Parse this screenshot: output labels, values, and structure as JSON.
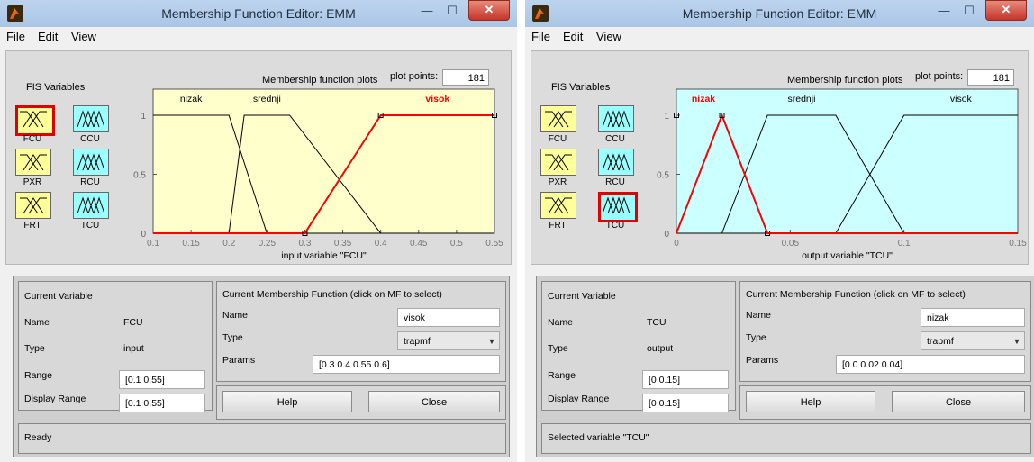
{
  "windows": [
    {
      "title": "Membership Function Editor: EMM",
      "menu": [
        "File",
        "Edit",
        "View"
      ],
      "fis_label": "FIS Variables",
      "variables": [
        {
          "name": "FCU",
          "kind": "input",
          "selected": true
        },
        {
          "name": "CCU",
          "kind": "output",
          "selected": false
        },
        {
          "name": "PXR",
          "kind": "input",
          "selected": false
        },
        {
          "name": "RCU",
          "kind": "output",
          "selected": false
        },
        {
          "name": "FRT",
          "kind": "input",
          "selected": false
        },
        {
          "name": "TCU",
          "kind": "output",
          "selected": false
        }
      ],
      "plot_header": "Membership function plots",
      "plot_points_label": "plot points:",
      "plot_points": "181",
      "chart_data": {
        "type": "line",
        "background": "#ffffcc",
        "xlabel": "input variable \"FCU\"",
        "xlim": [
          0.1,
          0.55
        ],
        "ylim": [
          0,
          1
        ],
        "xticks": [
          "0.1",
          "0.15",
          "0.2",
          "0.25",
          "0.3",
          "0.35",
          "0.4",
          "0.45",
          "0.5",
          "0.55"
        ],
        "yticks": [
          "0",
          "0.5",
          "1"
        ],
        "series": [
          {
            "name": "nizak",
            "params": [
              0.05,
              0.1,
              0.2,
              0.25
            ],
            "selected": false
          },
          {
            "name": "srednji",
            "params": [
              0.2,
              0.22,
              0.28,
              0.4
            ],
            "selected": false
          },
          {
            "name": "visok",
            "params": [
              0.3,
              0.4,
              0.55,
              0.6
            ],
            "selected": true
          }
        ]
      },
      "current_variable": {
        "header": "Current Variable",
        "name_label": "Name",
        "name": "FCU",
        "type_label": "Type",
        "type": "input",
        "range_label": "Range",
        "range": "[0.1 0.55]",
        "display_range_label": "Display Range",
        "display_range": "[0.1 0.55]"
      },
      "current_mf": {
        "header": "Current Membership Function (click on MF to select)",
        "name_label": "Name",
        "name": "visok",
        "type_label": "Type",
        "type": "trapmf",
        "params_label": "Params",
        "params": "[0.3 0.4 0.55 0.6]"
      },
      "help_label": "Help",
      "close_label": "Close",
      "status": "Ready"
    },
    {
      "title": "Membership Function Editor: EMM",
      "menu": [
        "File",
        "Edit",
        "View"
      ],
      "fis_label": "FIS Variables",
      "variables": [
        {
          "name": "FCU",
          "kind": "input",
          "selected": false
        },
        {
          "name": "CCU",
          "kind": "output",
          "selected": false
        },
        {
          "name": "PXR",
          "kind": "input",
          "selected": false
        },
        {
          "name": "RCU",
          "kind": "output",
          "selected": false
        },
        {
          "name": "FRT",
          "kind": "input",
          "selected": false
        },
        {
          "name": "TCU",
          "kind": "output",
          "selected": true
        }
      ],
      "plot_header": "Membership function plots",
      "plot_points_label": "plot points:",
      "plot_points": "181",
      "chart_data": {
        "type": "line",
        "background": "#ccffff",
        "xlabel": "output variable \"TCU\"",
        "xlim": [
          0,
          0.15
        ],
        "ylim": [
          0,
          1
        ],
        "xticks": [
          "0",
          "0.05",
          "0.1",
          "0.15"
        ],
        "yticks": [
          "0",
          "0.5",
          "1"
        ],
        "series": [
          {
            "name": "nizak",
            "params": [
              0,
              0,
              0.02,
              0.04
            ],
            "selected": true
          },
          {
            "name": "srednji",
            "params": [
              0.02,
              0.04,
              0.07,
              0.1
            ],
            "selected": false
          },
          {
            "name": "visok",
            "params": [
              0.07,
              0.1,
              0.15,
              0.16
            ],
            "selected": false
          }
        ]
      },
      "current_variable": {
        "header": "Current Variable",
        "name_label": "Name",
        "name": "TCU",
        "type_label": "Type",
        "type": "output",
        "range_label": "Range",
        "range": "[0 0.15]",
        "display_range_label": "Display Range",
        "display_range": "[0 0.15]"
      },
      "current_mf": {
        "header": "Current Membership Function (click on MF to select)",
        "name_label": "Name",
        "name": "nizak",
        "type_label": "Type",
        "type": "trapmf",
        "params_label": "Params",
        "params": "[0 0 0.02 0.04]"
      },
      "help_label": "Help",
      "close_label": "Close",
      "status": "Selected variable \"TCU\""
    }
  ]
}
